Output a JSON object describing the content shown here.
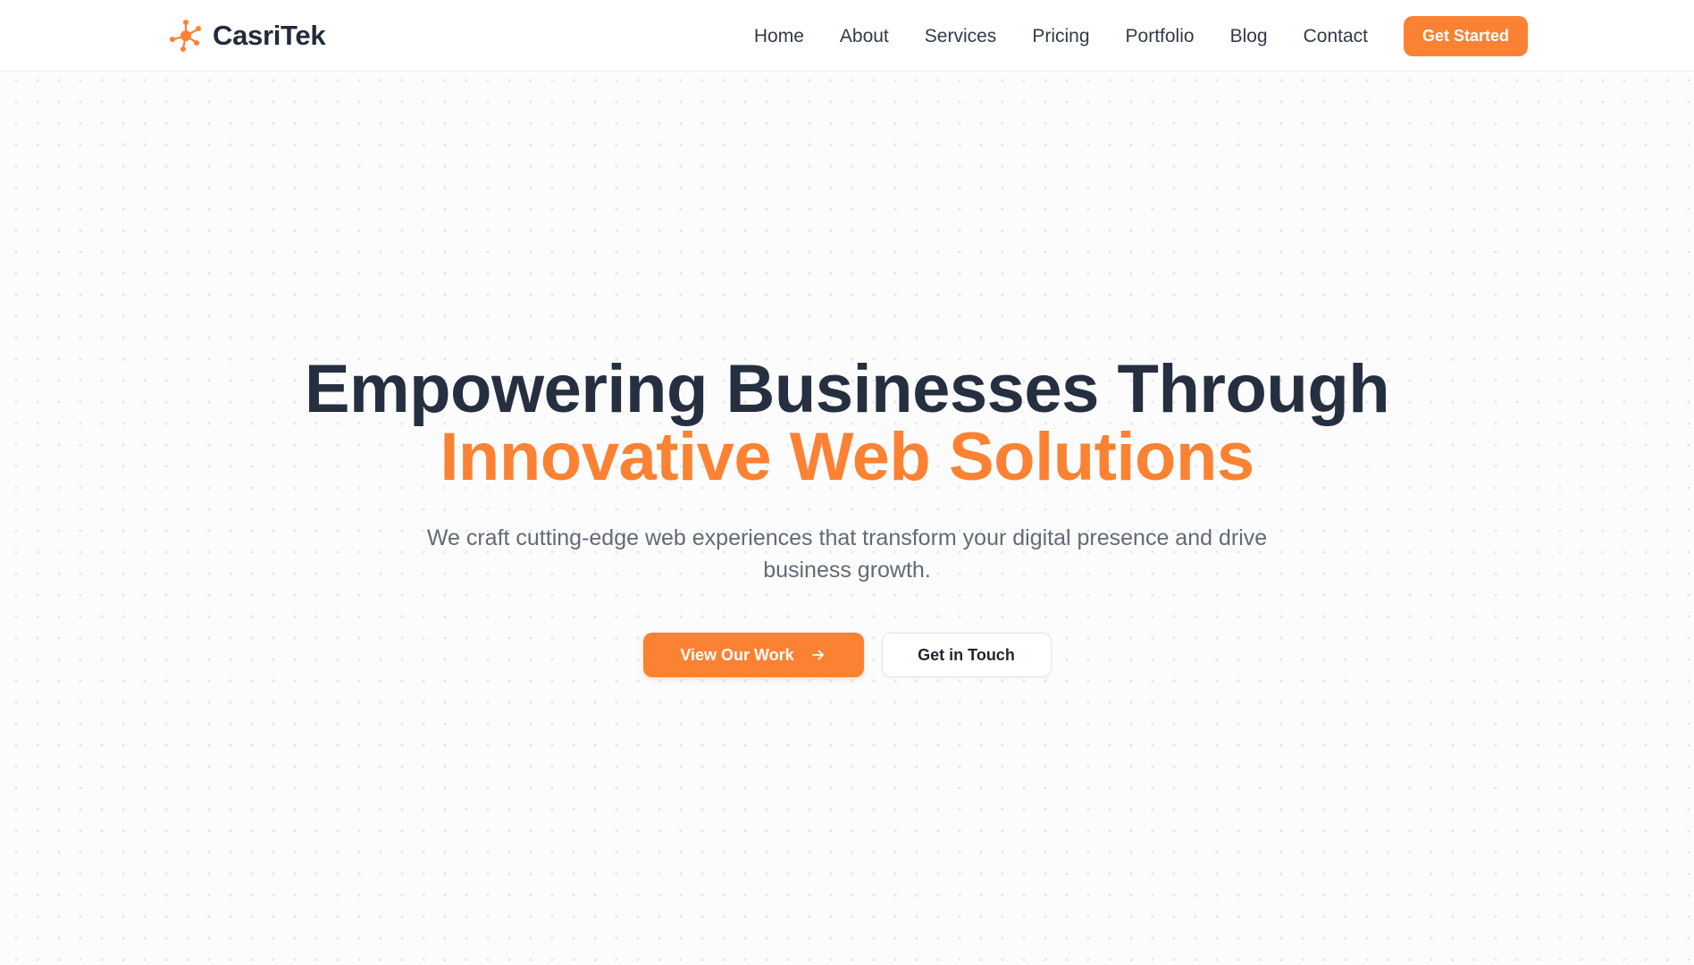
{
  "brand": {
    "name": "CasriTek",
    "logo_icon": "molecule-icon",
    "accent_color": "#fb8233"
  },
  "nav": {
    "items": [
      {
        "label": "Home"
      },
      {
        "label": "About"
      },
      {
        "label": "Services"
      },
      {
        "label": "Pricing"
      },
      {
        "label": "Portfolio"
      },
      {
        "label": "Blog"
      },
      {
        "label": "Contact"
      }
    ],
    "cta_label": "Get Started"
  },
  "hero": {
    "title_line1": "Empowering Businesses Through",
    "title_line2": "Innovative Web Solutions",
    "subtitle": "We craft cutting-edge web experiences that transform your digital presence and drive business growth.",
    "primary_button": {
      "label": "View Our Work",
      "icon": "arrow-right-icon"
    },
    "secondary_button": {
      "label": "Get in Touch"
    }
  },
  "colors": {
    "heading": "#252f3f",
    "accent": "#fb8233",
    "body_text": "#626a76"
  }
}
